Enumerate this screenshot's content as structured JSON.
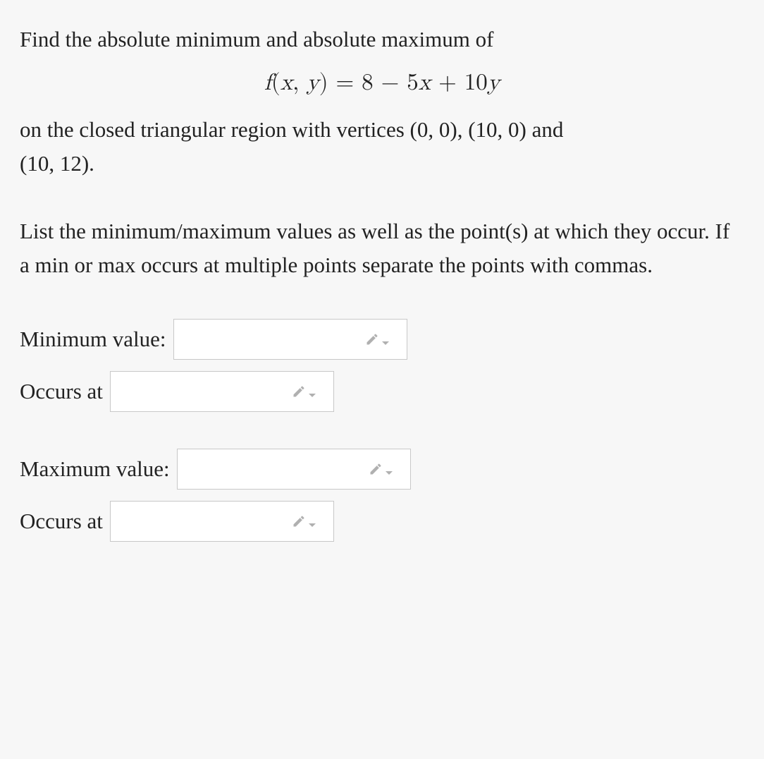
{
  "problem": {
    "intro": "Find the absolute minimum and absolute maximum of",
    "equation_lhs_f": "f",
    "equation_paren_open": "(",
    "equation_x": "x",
    "equation_comma": ", ",
    "equation_y": "y",
    "equation_paren_close": ")",
    "equation_eq": " = ",
    "equation_rhs": "8 − 5",
    "equation_rhs_x": "x",
    "equation_rhs_plus": " + 10",
    "equation_rhs_y": "y",
    "region_line1_a": "on the closed triangular region with vertices ",
    "region_v1": "(0, 0)",
    "region_sep1": ", ",
    "region_v2": "(10, 0)",
    "region_line1_b": " and",
    "region_v3": "(10, 12)",
    "region_period": ".",
    "instructions": "List the minimum/maximum values as well as the point(s) at which they occur. If a min or max occurs at multiple points separate the points with commas."
  },
  "answers": {
    "min_value_label": "Minimum value:",
    "min_value": "",
    "min_at_label": "Occurs at",
    "min_at": "",
    "max_value_label": "Maximum value:",
    "max_value": "",
    "max_at_label": "Occurs at",
    "max_at": ""
  }
}
